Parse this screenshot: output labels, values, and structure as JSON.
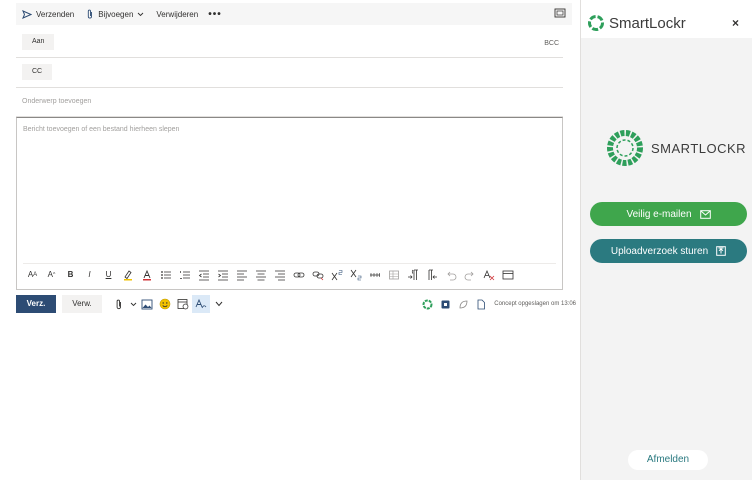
{
  "toolbar": {
    "send_label": "Verzenden",
    "attach_label": "Bijvoegen",
    "delete_label": "Verwijderen",
    "more_label": "•••"
  },
  "fields": {
    "to_label": "Aan",
    "cc_label": "CC",
    "bcc_label": "BCC",
    "subject_placeholder": "Onderwerp toevoegen",
    "body_placeholder": "Bericht toevoegen of een bestand hierheen slepen"
  },
  "format_toolbar": {
    "text_labels": [
      "A",
      "A",
      "B",
      "I",
      "U"
    ]
  },
  "bottom": {
    "send_button": "Verz.",
    "discard_button": "Verw.",
    "draft_status": "Concept opgeslagen om 13:06"
  },
  "addin": {
    "title": "SmartLockr",
    "close": "×",
    "wordmark": "SMARTLOCKR",
    "secure_email_button": "Veilig e-mailen",
    "upload_request_button": "Uploadverzoek sturen",
    "logout_button": "Afmelden"
  },
  "colors": {
    "send_blue": "#2d4c74",
    "secure_green": "#3fa64c",
    "upload_teal": "#2b7a80",
    "logo_green": "#2e9f5b"
  }
}
